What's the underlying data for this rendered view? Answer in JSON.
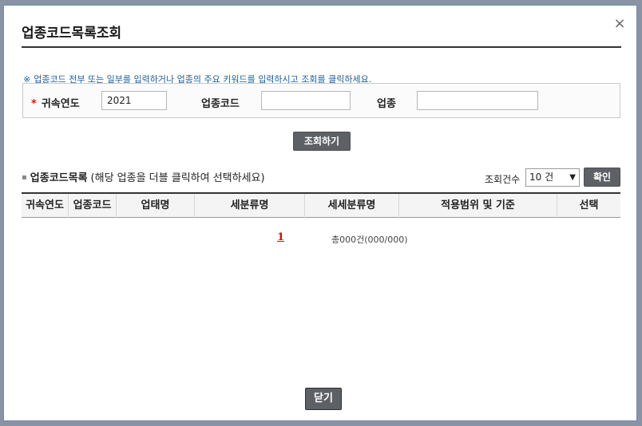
{
  "modal": {
    "title": "업종코드목록조회",
    "close_label": "×",
    "notice_mark": "※",
    "notice": "업종코드 전부 또는 일부를 입력하거나 업종의 주요 키워드를 입력하시고 조회를 클릭하세요."
  },
  "search": {
    "required_mark": "*",
    "year_label": "귀속연도",
    "year_value": "2021",
    "code_label": "업종코드",
    "code_value": "",
    "industry_label": "업종",
    "industry_value": "",
    "button": "조회하기"
  },
  "list": {
    "title": "업종코드목록",
    "hint": "(해당 업종을 더블 클릭하여 선택하세요)",
    "per_page_label": "조회건수",
    "per_page_value": "10 건",
    "confirm_button": "확인",
    "columns": [
      "귀속연도",
      "업종코드",
      "업태명",
      "세분류명",
      "세세분류명",
      "적용범위 및 기준",
      "선택"
    ]
  },
  "pagination": {
    "current_page": "1",
    "total_text": "총000건(000/000)"
  },
  "footer": {
    "close_button": "닫기"
  }
}
